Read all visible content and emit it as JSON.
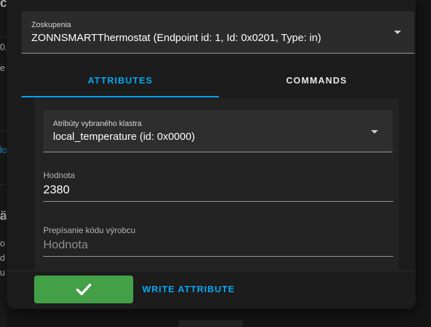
{
  "background": {
    "fragments": [
      {
        "text": "c"
      },
      {
        "text": "0,"
      },
      {
        "text": "e"
      },
      {
        "text": "lo"
      },
      {
        "text": "ä"
      },
      {
        "text": "o"
      },
      {
        "text": "d"
      },
      {
        "text": "u"
      }
    ]
  },
  "cluster_select": {
    "label": "Zoskupenia",
    "value": "ZONNSMARTThermostat (Endpoint id: 1, Id: 0x0201, Type: in)"
  },
  "tabs": [
    {
      "label": "ATTRIBUTES",
      "active": true
    },
    {
      "label": "COMMANDS",
      "active": false
    }
  ],
  "attribute_select": {
    "label": "Atribúty vybraného klastra",
    "value": "local_temperature (id: 0x0000)"
  },
  "value_field": {
    "label": "Hodnota",
    "value": "2380"
  },
  "manufacturer_field": {
    "label": "Prepísanie kódu výrobcu",
    "placeholder": "Hodnota"
  },
  "actions": {
    "write_label": "WRITE ATTRIBUTE",
    "check_icon": "check-icon"
  },
  "colors": {
    "accent": "#03a9f4",
    "success": "#43a047",
    "dialog_bg": "#1c1c1c"
  }
}
